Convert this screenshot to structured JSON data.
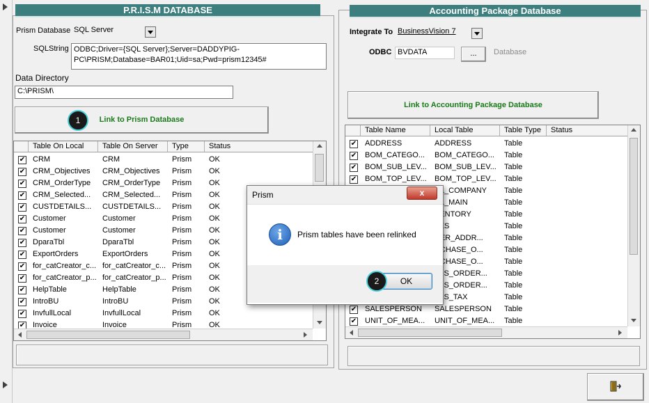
{
  "prism_panel": {
    "title": "P.R.I.S.M DATABASE",
    "db_label": "Prism Database",
    "db_value": "SQL Server",
    "sqlstring_label": "SQLString",
    "sqlstring_line1": "ODBC;Driver={SQL Server};Server=DADDYPIG-",
    "sqlstring_line2": "PC\\PRISM;Database=BAR01;Uid=sa;Pwd=prism12345#",
    "datadir_label": "Data Directory",
    "datadir_value": "C:\\PRISM\\",
    "link_button": "Link to Prism Database",
    "grid": {
      "headers": [
        "Table On Local",
        "Table On Server",
        "Type",
        "Status"
      ],
      "rows": [
        {
          "local": "CRM",
          "server": "CRM",
          "type": "Prism",
          "status": "OK"
        },
        {
          "local": "CRM_Objectives",
          "server": "CRM_Objectives",
          "type": "Prism",
          "status": "OK"
        },
        {
          "local": "CRM_OrderType",
          "server": "CRM_OrderType",
          "type": "Prism",
          "status": "OK"
        },
        {
          "local": "CRM_Selected...",
          "server": "CRM_Selected...",
          "type": "Prism",
          "status": "OK"
        },
        {
          "local": "CUSTDETAILS...",
          "server": "CUSTDETAILS...",
          "type": "Prism",
          "status": "OK"
        },
        {
          "local": "Customer",
          "server": "Customer",
          "type": "Prism",
          "status": "OK"
        },
        {
          "local": "Customer",
          "server": "Customer",
          "type": "Prism",
          "status": "OK"
        },
        {
          "local": "DparaTbl",
          "server": "DparaTbl",
          "type": "Prism",
          "status": "OK"
        },
        {
          "local": "ExportOrders",
          "server": "ExportOrders",
          "type": "Prism",
          "status": "OK"
        },
        {
          "local": "for_catCreator_c...",
          "server": "for_catCreator_c...",
          "type": "Prism",
          "status": "OK"
        },
        {
          "local": "for_catCreator_p...",
          "server": "for_catCreator_p...",
          "type": "Prism",
          "status": "OK"
        },
        {
          "local": "HelpTable",
          "server": "HelpTable",
          "type": "Prism",
          "status": "OK"
        },
        {
          "local": "IntroBU",
          "server": "IntroBU",
          "type": "Prism",
          "status": "OK"
        },
        {
          "local": "InvfullLocal",
          "server": "InvfullLocal",
          "type": "Prism",
          "status": "OK"
        },
        {
          "local": "Invoice",
          "server": "Invoice",
          "type": "Prism",
          "status": "OK"
        }
      ]
    }
  },
  "acct_panel": {
    "title": "Accounting Package Database",
    "integrate_label": "Integrate To :",
    "integrate_value": "BusinessVision 7",
    "odbc_label": "ODBC",
    "odbc_value": "BVDATA",
    "browse_button": "...",
    "database_label": "Database",
    "link_button": "Link to Accounting Package Database",
    "grid": {
      "headers": [
        "Table Name",
        "Local Table",
        "Table Type",
        "Status"
      ],
      "rows": [
        {
          "name": "ADDRESS",
          "local": "ADDRESS",
          "type": "Table",
          "status": ""
        },
        {
          "name": "BOM_CATEGO...",
          "local": "BOM_CATEGO...",
          "type": "Table",
          "status": ""
        },
        {
          "name": "BOM_SUB_LEV...",
          "local": "BOM_SUB_LEV...",
          "type": "Table",
          "status": ""
        },
        {
          "name": "BOM_TOP_LEV...",
          "local": "BOM_TOP_LEV...",
          "type": "Table",
          "status": ""
        },
        {
          "name": "",
          "local": "RL_COMPANY",
          "type": "Table",
          "status": ""
        },
        {
          "name": "",
          "local": "RL_MAIN",
          "type": "Table",
          "status": ""
        },
        {
          "name": "",
          "local": "VENTORY",
          "type": "Table",
          "status": ""
        },
        {
          "name": "",
          "local": "TES",
          "type": "Table",
          "status": ""
        },
        {
          "name": "",
          "local": "DER_ADDR...",
          "type": "Table",
          "status": ""
        },
        {
          "name": "",
          "local": "RCHASE_O...",
          "type": "Table",
          "status": ""
        },
        {
          "name": "",
          "local": "RCHASE_O...",
          "type": "Table",
          "status": ""
        },
        {
          "name": "",
          "local": "LES_ORDER...",
          "type": "Table",
          "status": ""
        },
        {
          "name": "",
          "local": "LES_ORDER...",
          "type": "Table",
          "status": ""
        },
        {
          "name": "",
          "local": "LES_TAX",
          "type": "Table",
          "status": ""
        },
        {
          "name": "SALESPERSON",
          "local": "SALESPERSON",
          "type": "Table",
          "status": ""
        },
        {
          "name": "UNIT_OF_MEA...",
          "local": "UNIT_OF_MEA...",
          "type": "Table",
          "status": ""
        }
      ]
    }
  },
  "dialog": {
    "title": "Prism",
    "close_glyph": "x",
    "message": "Prism tables have been relinked",
    "ok_label": "OK"
  },
  "badges": [
    "1",
    "2"
  ],
  "colors": {
    "header_bg": "#3d7f7f",
    "link_text": "#1a7a1a",
    "badge_ring": "#4ad0d8"
  },
  "icons": {
    "info": "info-icon",
    "exit": "exit-door-icon",
    "check": "checkmark-icon"
  }
}
